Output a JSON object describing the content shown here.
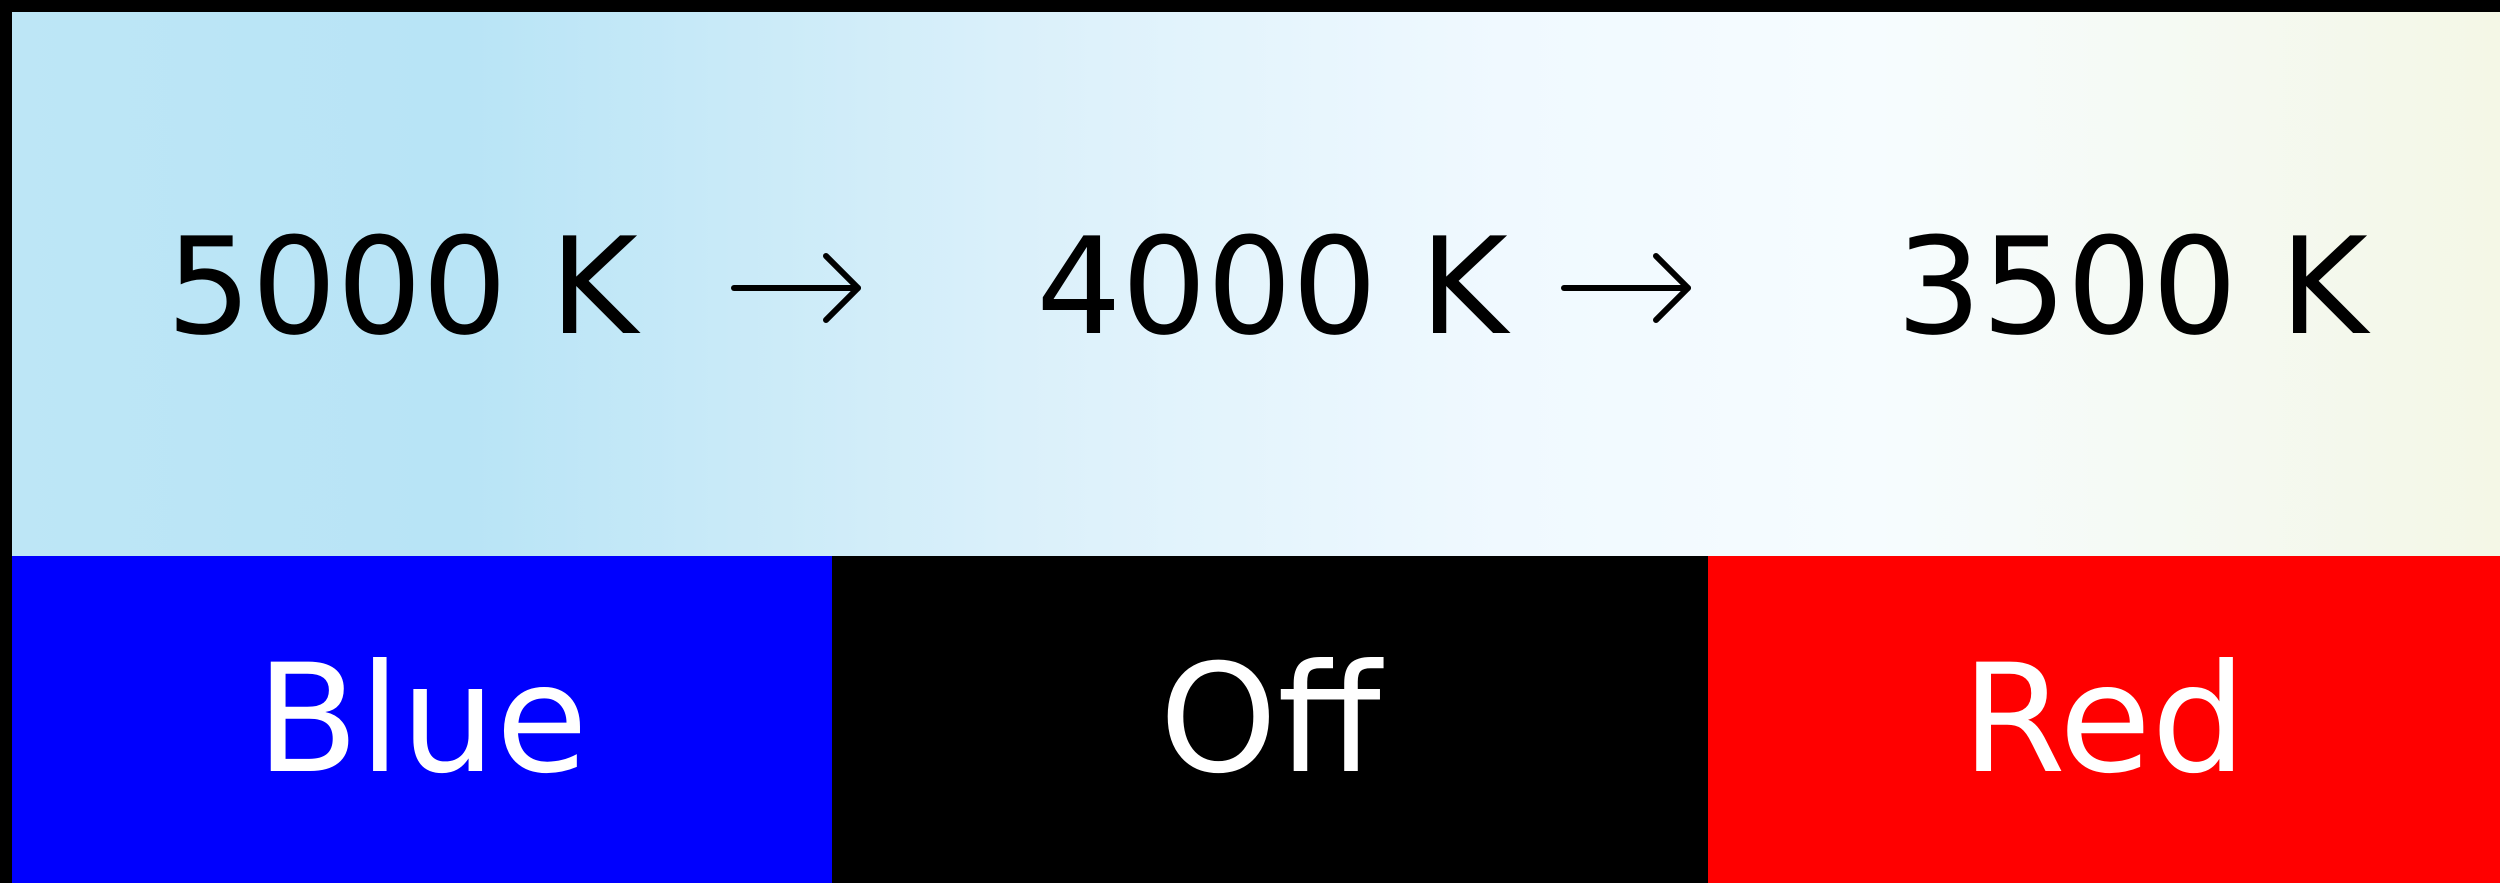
{
  "temperatures": [
    "5000 K",
    "4000 K",
    "3500 K"
  ],
  "arrow_icon": "right-arrow",
  "modes": [
    {
      "label": "Blue",
      "color": "#0000fe"
    },
    {
      "label": "Off",
      "color": "#000000"
    },
    {
      "label": "Red",
      "color": "#ff0000"
    }
  ],
  "gradient_colors": [
    "#b8e4f6",
    "#f6fcff",
    "#f4f7e6"
  ]
}
